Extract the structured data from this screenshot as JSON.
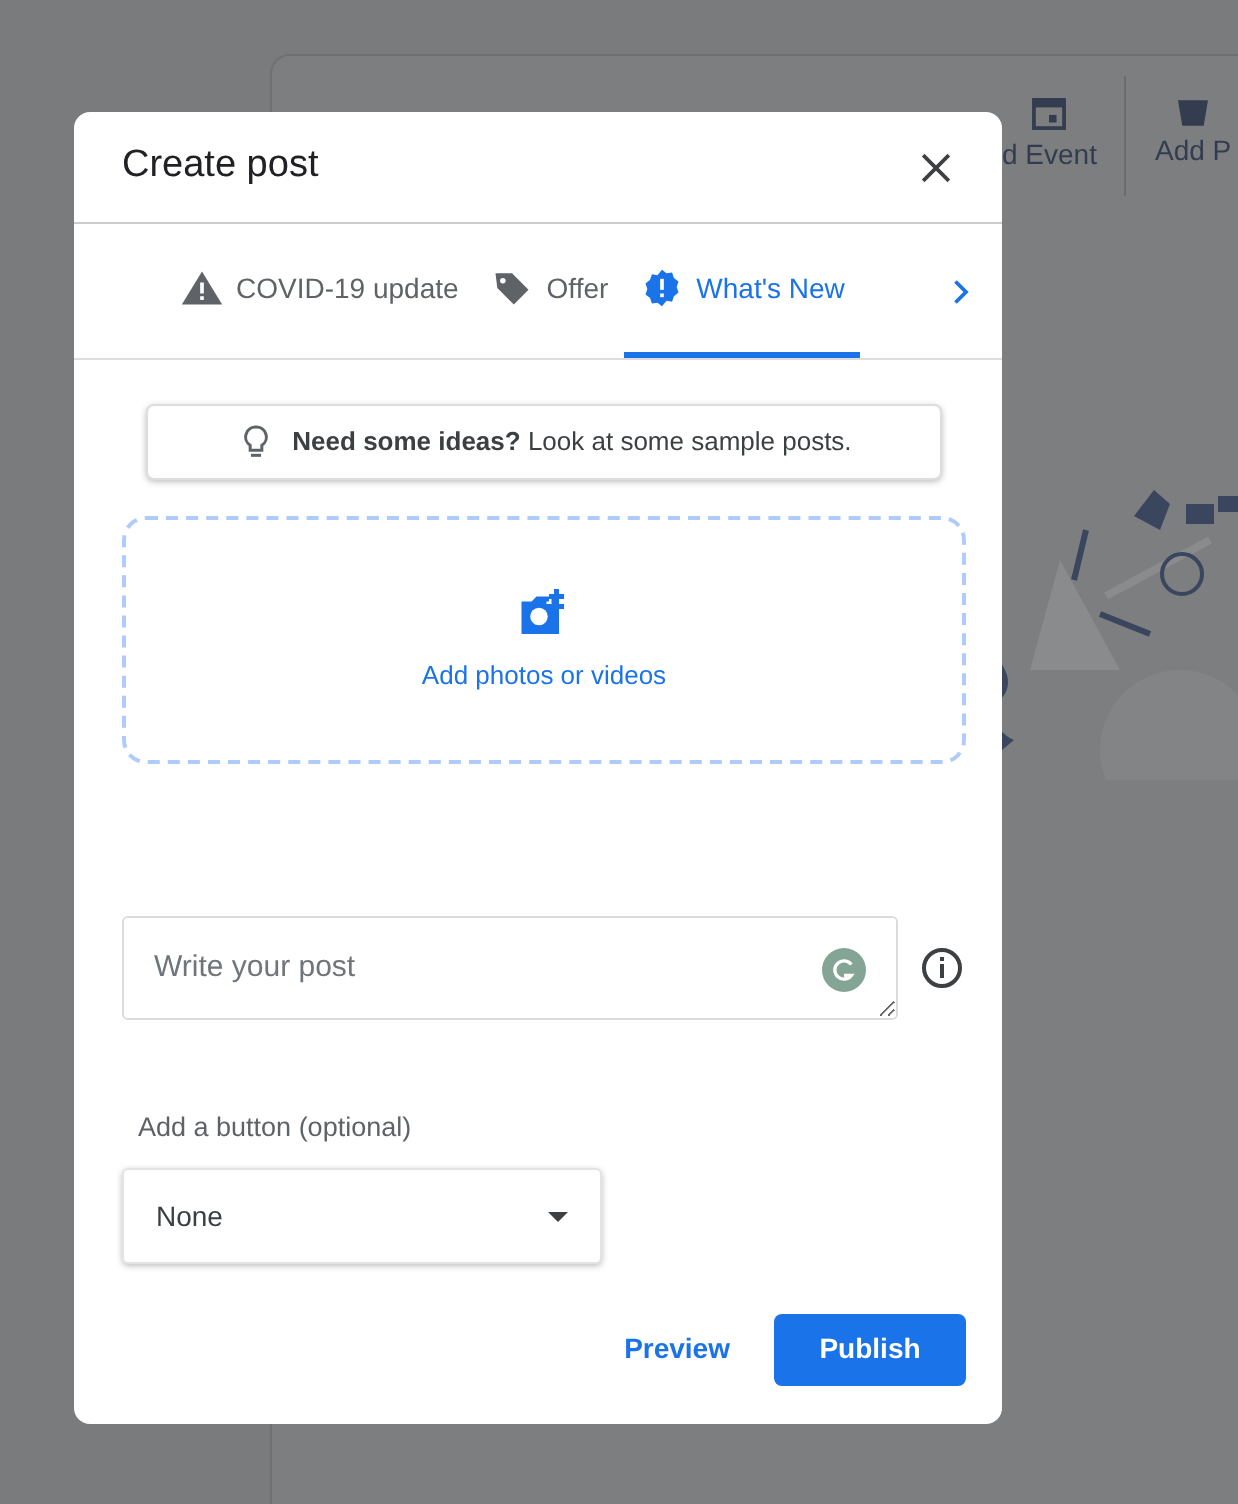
{
  "background_toolbar": {
    "items": [
      "d Event",
      "Add P"
    ]
  },
  "dialog": {
    "title": "Create post",
    "tabs": [
      {
        "label": "COVID-19 update",
        "selected": false
      },
      {
        "label": "Offer",
        "selected": false
      },
      {
        "label": "What's New",
        "selected": true
      }
    ],
    "ideas_banner": "**Need some ideas?** Look at some sample posts.",
    "media_upload": {
      "label": "Add photos or videos"
    },
    "post_field": {
      "placeholder": "Write your post"
    },
    "button_select": {
      "label": "Add a button (optional)",
      "value": "None"
    },
    "actions": {
      "secondary": "Preview",
      "primary": "Publish"
    }
  }
}
